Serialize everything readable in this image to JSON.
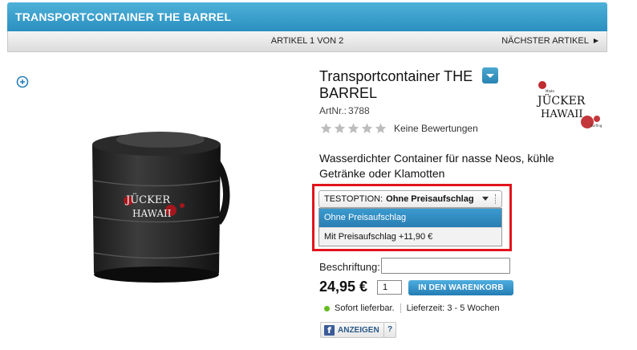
{
  "header": {
    "title": "TRANSPORTCONTAINER THE BARREL"
  },
  "navigation": {
    "counter": "ARTIKEL 1 VON 2",
    "next_label": "NÄCHSTER ARTIKEL"
  },
  "product": {
    "title": "Transportcontainer THE BARREL",
    "artnr_label": "ArtNr.:",
    "artnr_value": "3788",
    "rating_stars": 0,
    "rating_max": 5,
    "reviews_text": "Keine Bewertungen",
    "description": "Wasserdichter Container für nasse Neos, kühle Getränke oder Klamotten",
    "image_brand_top": "JÜCKER",
    "image_brand_bottom": "HAWAII"
  },
  "brand_logo": {
    "top_small": "Made",
    "line1": "JÜCKER",
    "line2": "HAWAII",
    "sub": "Surfing"
  },
  "option": {
    "label": "TESTOPTION:",
    "selected": "Ohne Preisaufschlag",
    "choices": [
      "Ohne Preisaufschlag",
      "Mit Preisaufschlag +11,90 €"
    ]
  },
  "caption": {
    "label": "Beschriftung:",
    "value": ""
  },
  "purchase": {
    "price": "24,95 €",
    "quantity": "1",
    "cart_button": "IN DEN WARENKORB"
  },
  "availability": {
    "status": "Sofort lieferbar.",
    "delivery": "Lieferzeit: 3 - 5 Wochen"
  },
  "social": {
    "fb_letter": "f",
    "share_label": "ANZEIGEN",
    "help": "?"
  },
  "colors": {
    "accent": "#2b8fc0",
    "highlight": "#e2141c",
    "in_stock": "#66bb22",
    "facebook": "#3b5b98"
  },
  "icons": [
    "zoom-in-icon",
    "chevron-down-icon",
    "star-icon",
    "facebook-icon",
    "help-icon",
    "arrow-right-icon"
  ]
}
